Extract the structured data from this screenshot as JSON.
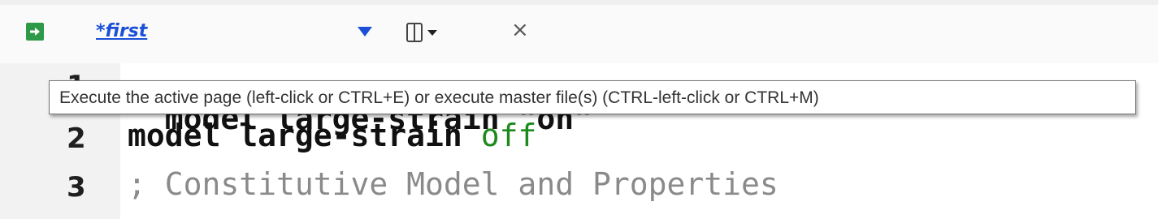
{
  "tab": {
    "title": "*first",
    "execute_icon": "run-arrow-icon",
    "dropdown_icon": "triangle-down-icon",
    "split_icon": "split-view-icon",
    "close_icon": "close-icon",
    "close_glyph": "×"
  },
  "tooltip": {
    "text": "Execute the active page (left-click or CTRL+E) or execute master file(s) (CTRL-left-click or CTRL+M)"
  },
  "editor": {
    "lines": [
      {
        "number": "1",
        "keyword": "model large-strain \"on\"",
        "value": ""
      },
      {
        "number": "2",
        "keyword": "model large-strain",
        "value": "off"
      },
      {
        "number": "3",
        "comment": "; Constitutive Model and Properties"
      }
    ]
  },
  "colors": {
    "tab_title": "#1a4fd6",
    "execute_button": "#2e9a48",
    "value_green": "#1e8a1e",
    "comment_gray": "#8a8a8a"
  }
}
